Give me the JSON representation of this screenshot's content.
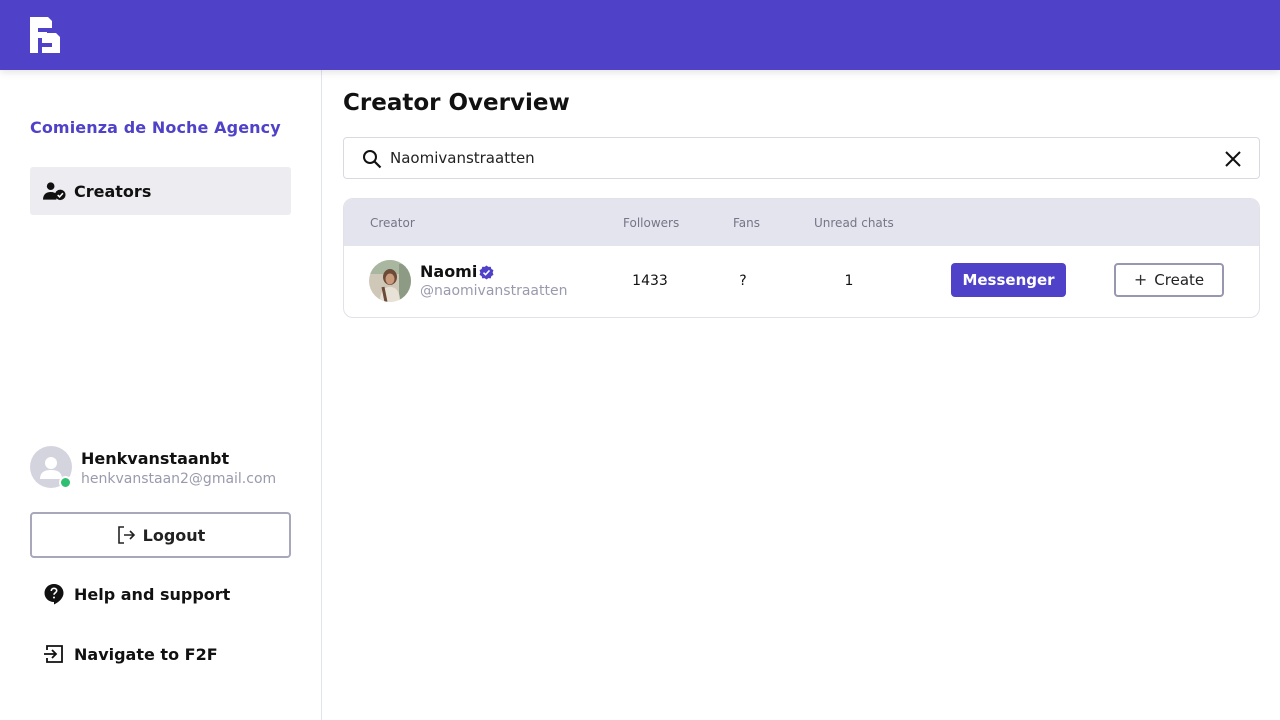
{
  "colors": {
    "brand": "#4f42c9",
    "online": "#2fbf71",
    "muted": "#9a9aae"
  },
  "sidebar": {
    "agency_name": "Comienza de Noche Agency",
    "nav": [
      {
        "label": "Creators",
        "icon": "user-check-icon",
        "active": true
      }
    ],
    "user": {
      "name": "Henkvanstaanbt",
      "email": "henkvanstaan2@gmail.com",
      "status": "online"
    },
    "logout_label": "Logout",
    "help_label": "Help and support",
    "navigate_label": "Navigate to F2F"
  },
  "main": {
    "title": "Creator Overview",
    "search": {
      "value": "Naomivanstraatten"
    },
    "table": {
      "columns": [
        "Creator",
        "Followers",
        "Fans",
        "Unread chats"
      ],
      "rows": [
        {
          "name": "Naomi",
          "verified": true,
          "handle": "@naomivanstraatten",
          "followers": "1433",
          "fans": "?",
          "unread": "1",
          "messenger_label": "Messenger",
          "create_label": "Create",
          "create_icon": "+"
        }
      ]
    }
  }
}
